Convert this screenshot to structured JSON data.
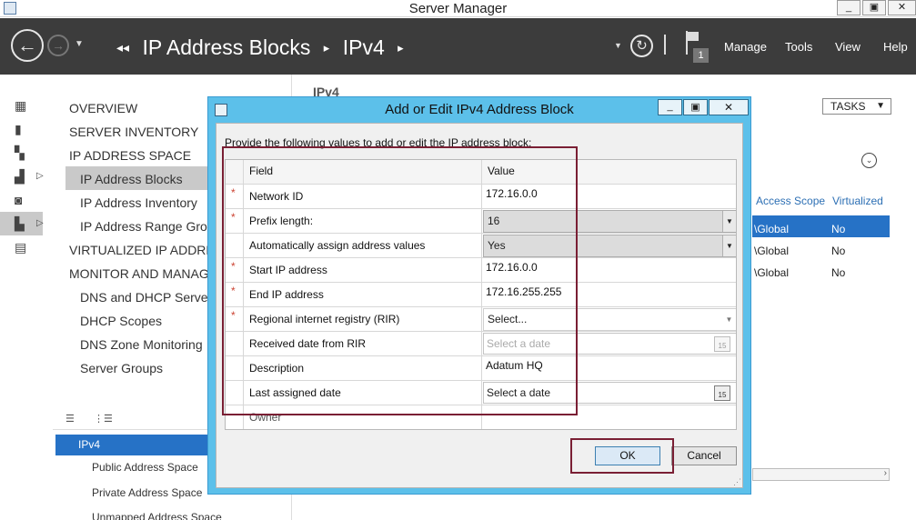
{
  "window": {
    "title": "Server Manager",
    "min": "_",
    "restore": "▣",
    "close": "✕"
  },
  "navbar": {
    "breadcrumb_prefix": "◂◂",
    "crumbs": [
      "IP Address Blocks",
      "IPv4"
    ],
    "sep": "▸",
    "notification_count": "1",
    "menu": [
      "Manage",
      "Tools",
      "View",
      "Help"
    ]
  },
  "nav": {
    "items": [
      {
        "label": "OVERVIEW"
      },
      {
        "label": "SERVER INVENTORY"
      },
      {
        "label": "IP ADDRESS SPACE"
      },
      {
        "label": "IP Address Blocks"
      },
      {
        "label": "IP Address Inventory"
      },
      {
        "label": "IP Address Range Grou"
      },
      {
        "label": "VIRTUALIZED IP ADDRES"
      },
      {
        "label": "MONITOR AND MANAG"
      },
      {
        "label": "DNS and DHCP Servers"
      },
      {
        "label": "DHCP Scopes"
      },
      {
        "label": "DNS Zone Monitoring"
      },
      {
        "label": "Server Groups"
      }
    ],
    "tree": [
      {
        "label": "IPv4"
      },
      {
        "label": "Public Address Space"
      },
      {
        "label": "Private Address Space"
      },
      {
        "label": "Unmapped Address Space"
      }
    ]
  },
  "main": {
    "heading": "IPv4",
    "tasks_label": "TASKS",
    "columns": [
      "Access Scope",
      "Virtualized"
    ],
    "rows": [
      {
        "scope": "\\Global",
        "virtualized": "No"
      },
      {
        "scope": "\\Global",
        "virtualized": "No"
      },
      {
        "scope": "\\Global",
        "virtualized": "No"
      }
    ]
  },
  "dialog": {
    "title": "Add or Edit IPv4 Address Block",
    "instructions": "Provide the following values to add or edit the IP address block:",
    "col_field": "Field",
    "col_value": "Value",
    "fields": [
      {
        "label": "Network ID",
        "required": "*",
        "value": "172.16.0.0"
      },
      {
        "label": "Prefix length:",
        "required": "*",
        "value": "16"
      },
      {
        "label": "Automatically assign address values",
        "required": "",
        "value": "Yes"
      },
      {
        "label": "Start IP address",
        "required": "*",
        "value": "172.16.0.0"
      },
      {
        "label": "End IP address",
        "required": "*",
        "value": "172.16.255.255"
      },
      {
        "label": "Regional internet registry (RIR)",
        "required": "*",
        "value": "Select..."
      },
      {
        "label": "Received date from RIR",
        "required": "",
        "value": "Select a date"
      },
      {
        "label": "Description",
        "required": "",
        "value": "Adatum HQ"
      },
      {
        "label": "Last assigned date",
        "required": "",
        "value": "Select a date"
      },
      {
        "label": "Owner",
        "required": "",
        "value": ""
      }
    ],
    "calendar_day": "15",
    "ok_label": "OK",
    "cancel_label": "Cancel"
  },
  "colors": {
    "accent": "#2672c6",
    "dialog_frame": "#5cc0ea",
    "highlight_box": "#7a1f34",
    "navbar": "#3c3c3c"
  }
}
